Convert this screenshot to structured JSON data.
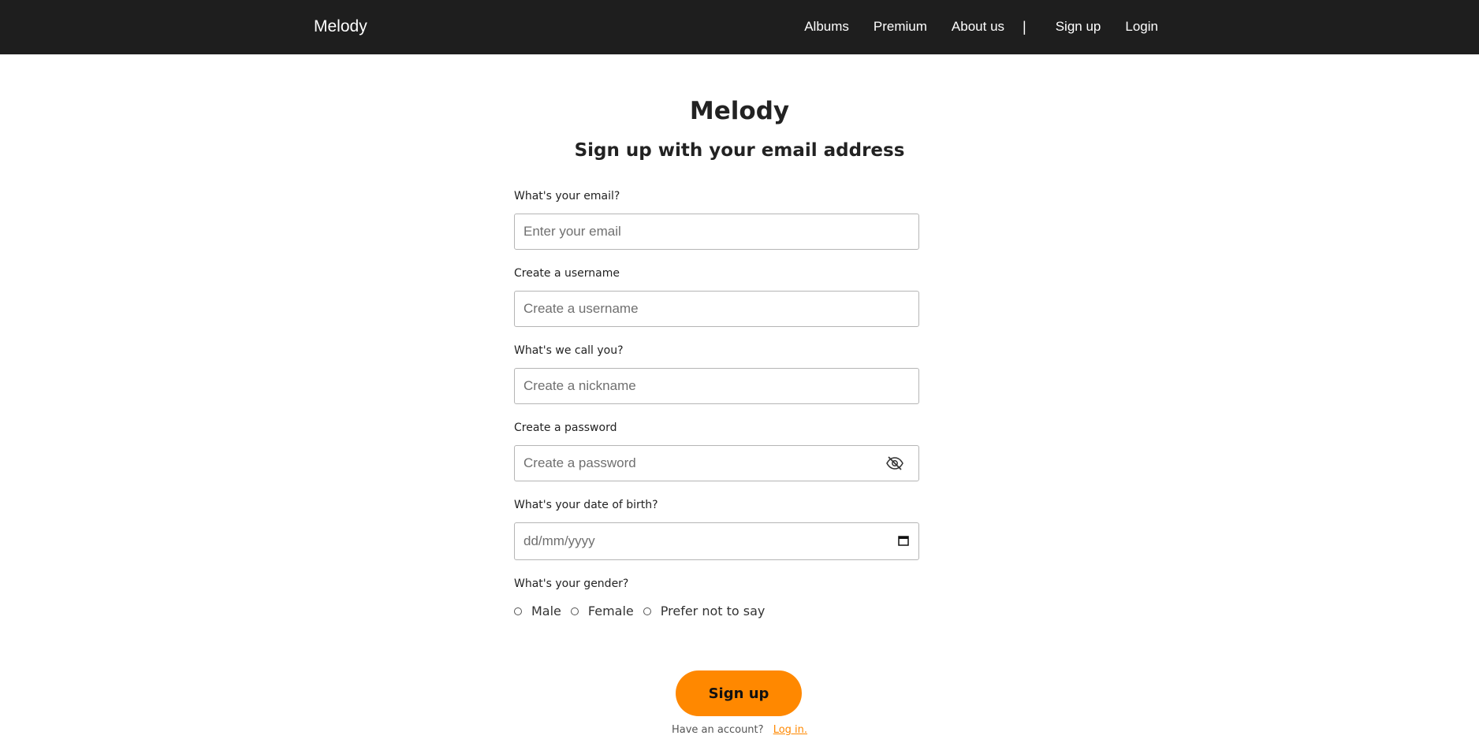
{
  "navbar": {
    "brand": "Melody",
    "links": [
      "Albums",
      "Premium",
      "About us"
    ],
    "separator": "|",
    "auth_links": [
      "Sign up",
      "Login"
    ]
  },
  "page": {
    "app_title": "Melody",
    "heading": "Sign up with your email address"
  },
  "form": {
    "email": {
      "label": "What's your email?",
      "placeholder": "Enter your email"
    },
    "username": {
      "label": "Create a username",
      "placeholder": "Create a username"
    },
    "nickname": {
      "label": "What's we call you?",
      "placeholder": "Create a nickname"
    },
    "password": {
      "label": "Create a password",
      "placeholder": "Create a password",
      "toggle_icon": "eye-off-icon"
    },
    "dob": {
      "label": "What's your date of birth?",
      "placeholder": "dd/mm/yyyy",
      "icon": "calendar-icon"
    },
    "gender": {
      "label": "What's your gender?",
      "options": [
        "Male",
        "Female",
        "Prefer not to say"
      ]
    },
    "submit_label": "Sign up"
  },
  "footer": {
    "prompt": "Have an account?",
    "login_link": "Log in."
  },
  "colors": {
    "navbar_bg": "#1e1e1e",
    "accent": "#ff8800"
  }
}
